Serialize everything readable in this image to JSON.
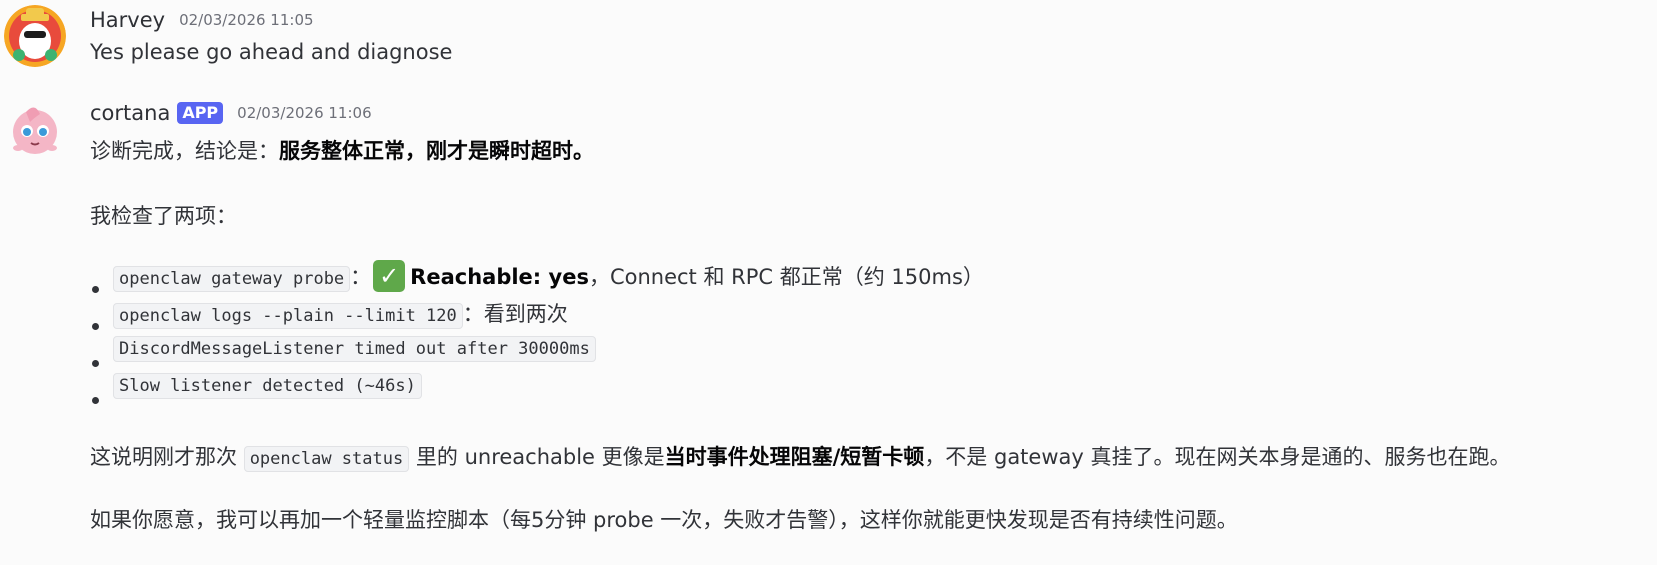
{
  "messages": [
    {
      "author": "Harvey",
      "timestamp": "02/03/2026 11:05",
      "avatar_icon": "cartoon-sheep-avatar",
      "text": "Yes please go ahead and diagnose"
    },
    {
      "author": "cortana",
      "badge": "APP",
      "timestamp": "02/03/2026 11:06",
      "avatar_icon": "jigglypuff-avatar",
      "line1_prefix": "诊断完成，结论是：",
      "line1_bold": "服务整体正常，刚才是瞬时超时。",
      "line2": "我检查了两项：",
      "bullets": [
        {
          "code": "openclaw gateway probe",
          "sep": "：",
          "check": "✓",
          "bold": "Reachable: yes",
          "rest": "，Connect 和 RPC 都正常（约 150ms）"
        },
        {
          "code": "openclaw logs --plain --limit 120",
          "rest": "：看到两次"
        },
        {
          "code": "DiscordMessageListener timed out after 30000ms"
        },
        {
          "code": "Slow listener detected (~46s)"
        }
      ],
      "para1_a": "这说明刚才那次 ",
      "para1_code": "openclaw status",
      "para1_b": " 里的 unreachable 更像是",
      "para1_bold": "当时事件处理阻塞/短暂卡顿",
      "para1_c": "，不是 gateway 真挂了。现在网关本身是通的、服务也在跑。",
      "para2": "如果你愿意，我可以再加一个轻量监控脚本（每5分钟 probe 一次，失败才告警），这样你就能更快发现是否有持续性问题。"
    }
  ]
}
